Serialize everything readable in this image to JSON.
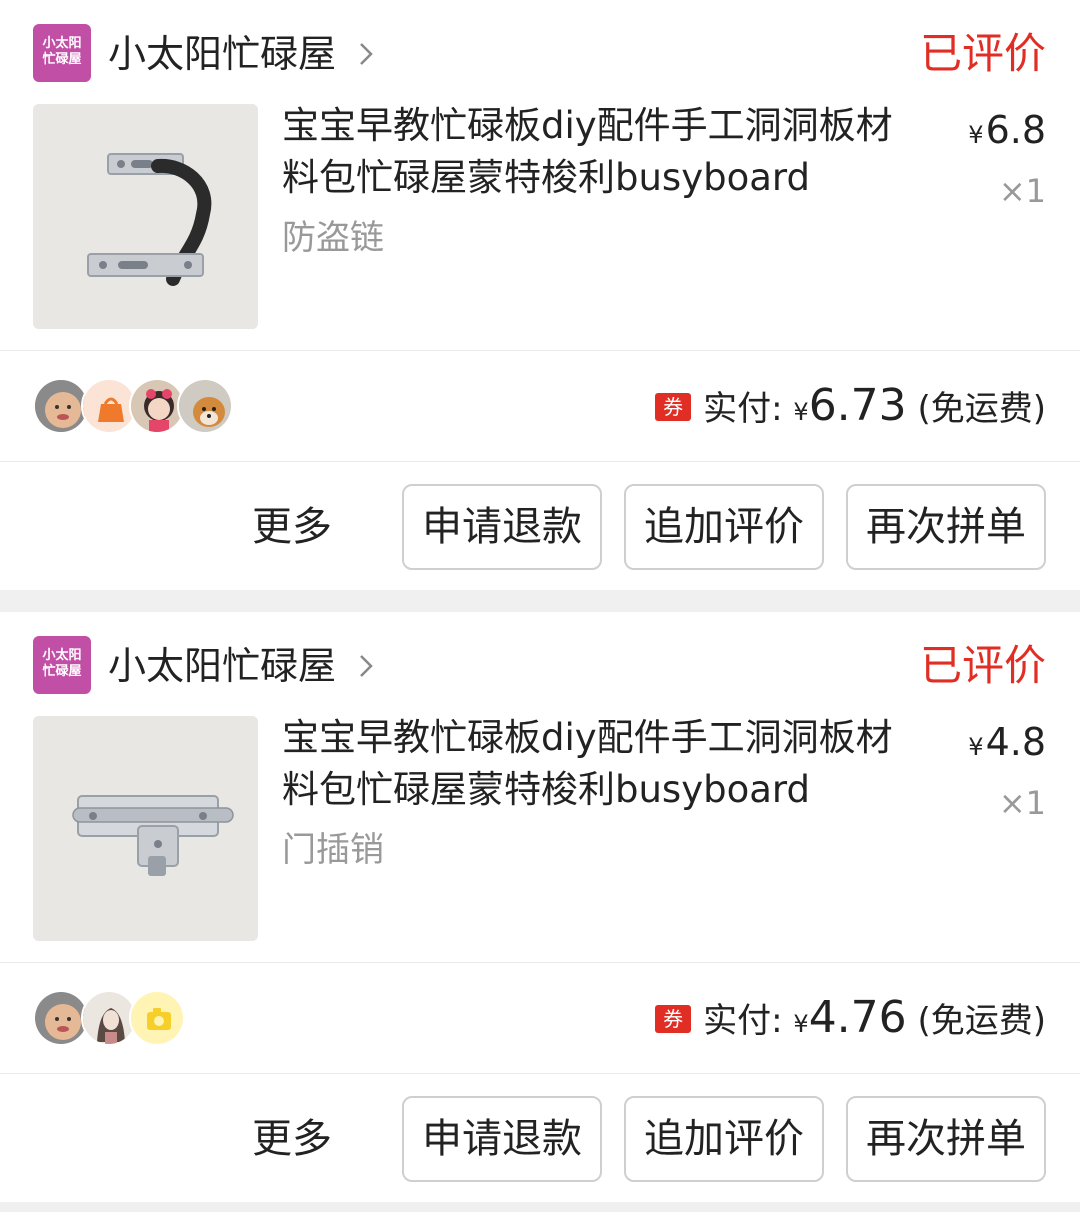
{
  "orders": [
    {
      "shop": {
        "logo_line1": "小太阳",
        "logo_line2": "忙碌屋",
        "name": "小太阳忙碌屋"
      },
      "status": "已评价",
      "item": {
        "title": "宝宝早教忙碌板diy配件手工洞洞板材料包忙碌屋蒙特梭利busyboard",
        "spec": "防盗链",
        "price_symbol": "¥",
        "price": "6.8",
        "quantity": "×1",
        "image_icon": "door-chain-image"
      },
      "avatars": [
        "avatar-baby",
        "avatar-orange-bag",
        "avatar-girl",
        "avatar-dog"
      ],
      "payment": {
        "coupon_badge": "券",
        "label": "实付:",
        "currency": "¥",
        "amount": "6.73",
        "shipping_note": "(免运费)"
      },
      "actions": {
        "more": "更多",
        "refund": "申请退款",
        "add_review": "追加评价",
        "reorder": "再次拼单"
      }
    },
    {
      "shop": {
        "logo_line1": "小太阳",
        "logo_line2": "忙碌屋",
        "name": "小太阳忙碌屋"
      },
      "status": "已评价",
      "item": {
        "title": "宝宝早教忙碌板diy配件手工洞洞板材料包忙碌屋蒙特梭利busyboard",
        "spec": "门插销",
        "price_symbol": "¥",
        "price": "4.8",
        "quantity": "×1",
        "image_icon": "door-bolt-image"
      },
      "avatars": [
        "avatar-baby",
        "avatar-sketch-girl",
        "avatar-yellow-camera"
      ],
      "payment": {
        "coupon_badge": "券",
        "label": "实付:",
        "currency": "¥",
        "amount": "4.76",
        "shipping_note": "(免运费)"
      },
      "actions": {
        "more": "更多",
        "refund": "申请退款",
        "add_review": "追加评价",
        "reorder": "再次拼单"
      }
    }
  ],
  "colors": {
    "accent": "#e02e24",
    "shop_logo": "#c24fa6",
    "muted": "#999999",
    "divider": "#ececec"
  }
}
